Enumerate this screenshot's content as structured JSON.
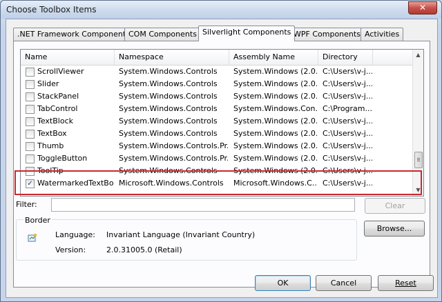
{
  "window": {
    "title": "Choose Toolbox Items",
    "close_glyph": "✕"
  },
  "tabs": [
    {
      "label": ".NET Framework Components",
      "active": false
    },
    {
      "label": "COM Components",
      "active": false
    },
    {
      "label": "Silverlight Components",
      "active": true
    },
    {
      "label": "WPF Components",
      "active": false
    },
    {
      "label": "Activities",
      "active": false
    }
  ],
  "columns": {
    "name": "Name",
    "namespace": "Namespace",
    "assembly": "Assembly Name",
    "directory": "Directory"
  },
  "rows": [
    {
      "checked": false,
      "name": "ScrollViewer",
      "namespace": "System.Windows.Controls",
      "assembly": "System.Windows (2.0....",
      "directory": "C:\\Users\\v-j..."
    },
    {
      "checked": false,
      "name": "Slider",
      "namespace": "System.Windows.Controls",
      "assembly": "System.Windows (2.0....",
      "directory": "C:\\Users\\v-j..."
    },
    {
      "checked": false,
      "name": "StackPanel",
      "namespace": "System.Windows.Controls",
      "assembly": "System.Windows (2.0....",
      "directory": "C:\\Users\\v-j..."
    },
    {
      "checked": false,
      "name": "TabControl",
      "namespace": "System.Windows.Controls",
      "assembly": "System.Windows.Con...",
      "directory": "C:\\Program..."
    },
    {
      "checked": false,
      "name": "TextBlock",
      "namespace": "System.Windows.Controls",
      "assembly": "System.Windows (2.0....",
      "directory": "C:\\Users\\v-j..."
    },
    {
      "checked": false,
      "name": "TextBox",
      "namespace": "System.Windows.Controls",
      "assembly": "System.Windows (2.0....",
      "directory": "C:\\Users\\v-j..."
    },
    {
      "checked": false,
      "name": "Thumb",
      "namespace": "System.Windows.Controls.Pr...",
      "assembly": "System.Windows (2.0....",
      "directory": "C:\\Users\\v-j..."
    },
    {
      "checked": false,
      "name": "ToggleButton",
      "namespace": "System.Windows.Controls.Pr...",
      "assembly": "System.Windows (2.0....",
      "directory": "C:\\Users\\v-j..."
    },
    {
      "checked": false,
      "name": "ToolTip",
      "namespace": "System.Windows.Controls",
      "assembly": "System.Windows (2.0....",
      "directory": "C:\\Users\\v-j..."
    },
    {
      "checked": true,
      "name": "WatermarkedTextBox",
      "namespace": "Microsoft.Windows.Controls",
      "assembly": "Microsoft.Windows.C...",
      "directory": "C:\\Users\\v-j..."
    }
  ],
  "filter": {
    "label": "Filter:",
    "value": "",
    "clear_label": "Clear"
  },
  "details": {
    "group_title": "Border",
    "language_label": "Language:",
    "language_value": "Invariant Language (Invariant Country)",
    "version_label": "Version:",
    "version_value": "2.0.31005.0 (Retail)"
  },
  "buttons": {
    "browse": "Browse...",
    "ok": "OK",
    "cancel": "Cancel",
    "reset": "Reset"
  },
  "colors": {
    "highlight_border": "#c8282d",
    "check_mark": "#1b3c75"
  }
}
